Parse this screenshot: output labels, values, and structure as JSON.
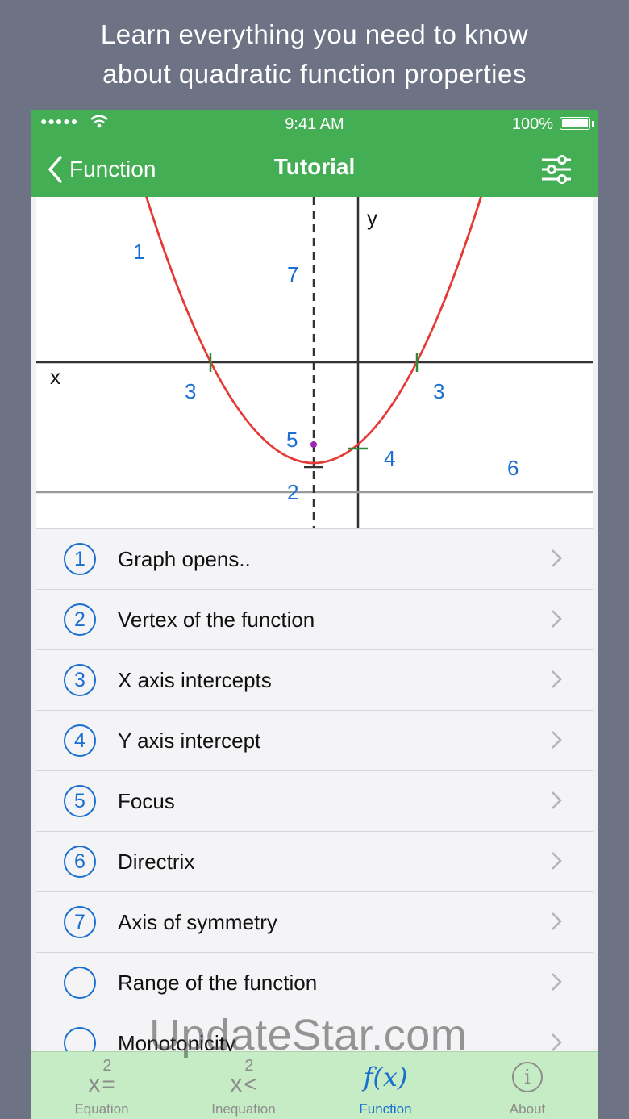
{
  "promo": {
    "line1": "Learn everything you need to know",
    "line2": "about quadratic function properties"
  },
  "status_bar": {
    "time": "9:41 AM",
    "battery": "100%"
  },
  "nav": {
    "back_label": "Function",
    "title": "Tutorial"
  },
  "graph": {
    "x_axis_label": "x",
    "y_axis_label": "y",
    "markers": {
      "opens": "1",
      "vertex": "2",
      "x_intercept_left": "3",
      "x_intercept_right": "3",
      "y_intercept": "4",
      "focus": "5",
      "directrix": "6",
      "axis_of_symmetry": "7"
    },
    "colors": {
      "curve": "#e53935",
      "ticks": "#2e8b3a",
      "focus": "#9c27b0",
      "marker": "#1a6fd1"
    }
  },
  "list": {
    "items": [
      {
        "num": "1",
        "label": "Graph opens.."
      },
      {
        "num": "2",
        "label": "Vertex of the function"
      },
      {
        "num": "3",
        "label": "X axis intercepts"
      },
      {
        "num": "4",
        "label": "Y axis intercept"
      },
      {
        "num": "5",
        "label": "Focus"
      },
      {
        "num": "6",
        "label": "Directrix"
      },
      {
        "num": "7",
        "label": "Axis of symmetry"
      },
      {
        "num": "",
        "label": "Range of the function"
      },
      {
        "num": "",
        "label": "Monotonicity"
      }
    ]
  },
  "tabbar": {
    "equation": {
      "icon_base": "x",
      "icon_sup": "2",
      "icon_op": "=",
      "label": "Equation"
    },
    "inequation": {
      "icon_base": "x",
      "icon_sup": "2",
      "icon_op": "<",
      "label": "Inequation"
    },
    "function": {
      "icon": "f(x)",
      "label": "Function"
    },
    "about": {
      "icon": "i",
      "label": "About"
    },
    "active": "function"
  },
  "watermark": "UpdateStar.com",
  "accent_color": "#43ae53",
  "link_color": "#1a6fd1"
}
